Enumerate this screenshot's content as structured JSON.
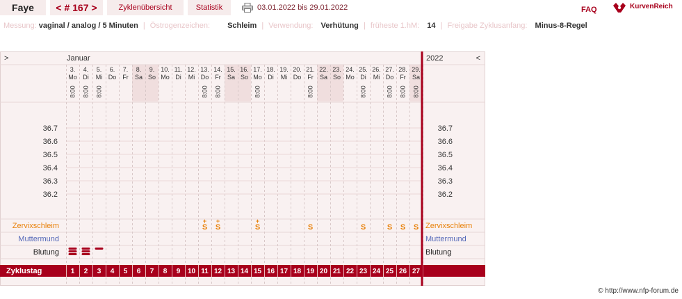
{
  "header": {
    "user_name": "Faye",
    "cycle_number": "< # 167 >",
    "overview_tab": "Zyklenübersicht",
    "statistics_tab": "Statistik",
    "date_range": "03.01.2022 bis 29.01.2022",
    "faq_label": "FAQ",
    "logo_text": "KurvenReich"
  },
  "info_bar": [
    {
      "label": "Messung:",
      "value": "vaginal / analog / 5 Minuten"
    },
    {
      "label": "Östrogenzeichen:",
      "value": "Schleim"
    },
    {
      "label": "Verwendung:",
      "value": "Verhütung"
    },
    {
      "label": "früheste 1.hM:",
      "value": "14"
    },
    {
      "label": "Freigabe Zyklusanfang:",
      "value": "Minus-8-Regel"
    }
  ],
  "chart": {
    "nav_prev": ">",
    "nav_next": "<",
    "month": "Januar",
    "year": "2022",
    "days": [
      {
        "date": "3.",
        "weekday": "Mo",
        "time": "8:00",
        "cycle_day": "1",
        "weekend": false,
        "bleeding": 3,
        "mucus": ""
      },
      {
        "date": "4.",
        "weekday": "Di",
        "time": "8:00",
        "cycle_day": "2",
        "weekend": false,
        "bleeding": 3,
        "mucus": ""
      },
      {
        "date": "5.",
        "weekday": "Mi",
        "time": "8:00",
        "cycle_day": "3",
        "weekend": false,
        "bleeding": 1,
        "mucus": ""
      },
      {
        "date": "6.",
        "weekday": "Do",
        "time": "",
        "cycle_day": "4",
        "weekend": false,
        "bleeding": 0,
        "mucus": ""
      },
      {
        "date": "7.",
        "weekday": "Fr",
        "time": "",
        "cycle_day": "5",
        "weekend": false,
        "bleeding": 0,
        "mucus": ""
      },
      {
        "date": "8.",
        "weekday": "Sa",
        "time": "",
        "cycle_day": "6",
        "weekend": true,
        "bleeding": 0,
        "mucus": ""
      },
      {
        "date": "9.",
        "weekday": "So",
        "time": "",
        "cycle_day": "7",
        "weekend": true,
        "bleeding": 0,
        "mucus": ""
      },
      {
        "date": "10.",
        "weekday": "Mo",
        "time": "",
        "cycle_day": "8",
        "weekend": false,
        "bleeding": 0,
        "mucus": ""
      },
      {
        "date": "11.",
        "weekday": "Di",
        "time": "",
        "cycle_day": "9",
        "weekend": false,
        "bleeding": 0,
        "mucus": ""
      },
      {
        "date": "12.",
        "weekday": "Mi",
        "time": "",
        "cycle_day": "10",
        "weekend": false,
        "bleeding": 0,
        "mucus": ""
      },
      {
        "date": "13.",
        "weekday": "Do",
        "time": "8:00",
        "cycle_day": "11",
        "weekend": false,
        "bleeding": 0,
        "mucus": "S+"
      },
      {
        "date": "14.",
        "weekday": "Fr",
        "time": "8:00",
        "cycle_day": "12",
        "weekend": false,
        "bleeding": 0,
        "mucus": "S+"
      },
      {
        "date": "15.",
        "weekday": "Sa",
        "time": "",
        "cycle_day": "13",
        "weekend": true,
        "bleeding": 0,
        "mucus": ""
      },
      {
        "date": "16.",
        "weekday": "So",
        "time": "",
        "cycle_day": "14",
        "weekend": true,
        "bleeding": 0,
        "mucus": ""
      },
      {
        "date": "17.",
        "weekday": "Mo",
        "time": "8:00",
        "cycle_day": "15",
        "weekend": false,
        "bleeding": 0,
        "mucus": "S+"
      },
      {
        "date": "18.",
        "weekday": "Di",
        "time": "",
        "cycle_day": "16",
        "weekend": false,
        "bleeding": 0,
        "mucus": ""
      },
      {
        "date": "19.",
        "weekday": "Mi",
        "time": "",
        "cycle_day": "17",
        "weekend": false,
        "bleeding": 0,
        "mucus": ""
      },
      {
        "date": "20.",
        "weekday": "Do",
        "time": "",
        "cycle_day": "18",
        "weekend": false,
        "bleeding": 0,
        "mucus": ""
      },
      {
        "date": "21.",
        "weekday": "Fr",
        "time": "8:00",
        "cycle_day": "19",
        "weekend": false,
        "bleeding": 0,
        "mucus": "S"
      },
      {
        "date": "22.",
        "weekday": "Sa",
        "time": "",
        "cycle_day": "20",
        "weekend": true,
        "bleeding": 0,
        "mucus": ""
      },
      {
        "date": "23.",
        "weekday": "So",
        "time": "",
        "cycle_day": "21",
        "weekend": true,
        "bleeding": 0,
        "mucus": ""
      },
      {
        "date": "24.",
        "weekday": "Mo",
        "time": "",
        "cycle_day": "22",
        "weekend": false,
        "bleeding": 0,
        "mucus": ""
      },
      {
        "date": "25.",
        "weekday": "Di",
        "time": "8:00",
        "cycle_day": "23",
        "weekend": false,
        "bleeding": 0,
        "mucus": "S"
      },
      {
        "date": "26.",
        "weekday": "Mi",
        "time": "",
        "cycle_day": "24",
        "weekend": false,
        "bleeding": 0,
        "mucus": ""
      },
      {
        "date": "27.",
        "weekday": "Do",
        "time": "8:00",
        "cycle_day": "25",
        "weekend": false,
        "bleeding": 0,
        "mucus": "S"
      },
      {
        "date": "28.",
        "weekday": "Fr",
        "time": "8:00",
        "cycle_day": "26",
        "weekend": false,
        "bleeding": 0,
        "mucus": "S"
      },
      {
        "date": "29.",
        "weekday": "Sa",
        "time": "8:00",
        "cycle_day": "27",
        "weekend": true,
        "bleeding": 0,
        "mucus": "S"
      }
    ],
    "temperature_labels": [
      "36.7",
      "36.6",
      "36.5",
      "36.4",
      "36.3",
      "36.2"
    ],
    "rows": {
      "mucus": "Zervixschleim",
      "cervix": "Muttermund",
      "bleeding": "Blutung",
      "cycle_day": "Zyklustag"
    },
    "colors": {
      "accent": "#a8001c",
      "mucus": "#e8820c",
      "cervix": "#5468b8",
      "background": "#f9f1f1",
      "weekend": "#f0dede"
    }
  },
  "footer": {
    "copyright": "© http://www.nfp-forum.de"
  }
}
